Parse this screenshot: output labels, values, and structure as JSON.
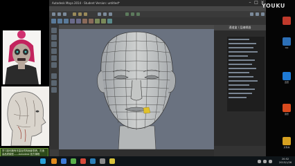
{
  "watermark": "YOUKU",
  "maya": {
    "title": "Autodesk Maya 2014 - Student Version: untitled*",
    "channel_box": {
      "header": "通道盒 / 层编辑器"
    }
  },
  "subtitle": "学习如何拥有丰富自然的面部表情，打造高品质模型——Autodesk 官方课程",
  "desktop": {
    "icons": [
      {
        "name": "aiqiyi-icon",
        "label": "",
        "color": "#c0392b"
      },
      {
        "name": "qq-icon",
        "label": "QQ",
        "color": "#2c6fb7"
      },
      {
        "name": "xunlei-icon",
        "label": "迅雷",
        "color": "#1e7ad6"
      },
      {
        "name": "music-icon",
        "label": "音乐",
        "color": "#d94a1e"
      },
      {
        "name": "folder-icon",
        "label": "文件夹",
        "color": "#d6a020"
      }
    ]
  },
  "clock": {
    "time": "20:52",
    "date": "2015/1/26"
  },
  "colors": {
    "viewport": "#6a7280",
    "mesh_face": "#c7c9c8",
    "mesh_lines": "#3a3a3a",
    "highlight": "#e0c12a"
  }
}
